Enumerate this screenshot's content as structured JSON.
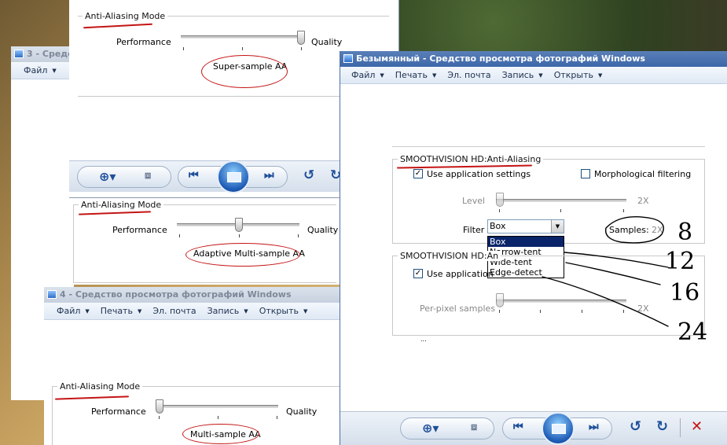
{
  "win_top": {
    "group_label": "Anti-Aliasing Mode",
    "left_label": "Performance",
    "right_label": "Quality",
    "mode": "Super-sample AA",
    "slider_level": 1.0
  },
  "win3": {
    "title": "3 - Средс",
    "menu": [
      "Файл"
    ]
  },
  "mid": {
    "group_label": "Anti-Aliasing Mode",
    "left_label": "Performance",
    "right_label": "Quality",
    "mode": "Adaptive Multi-sample AA",
    "slider_level": 0.5
  },
  "win4": {
    "title": "4 - Средство просмотра фотографий Windows",
    "menu": [
      "Файл",
      "Печать",
      "Эл. почта",
      "Запись",
      "Открыть"
    ],
    "group_label": "Anti-Aliasing Mode",
    "left_label": "Performance",
    "right_label": "Quality",
    "mode": "Multi-sample AA",
    "slider_level": 0.0
  },
  "main": {
    "title": "Безымянный - Средство просмотра фотографий Windows",
    "menu": [
      "Файл",
      "Печать",
      "Эл. почта",
      "Запись",
      "Открыть"
    ],
    "g1": {
      "label": "SMOOTHVISION HD:Anti-Aliasing",
      "use_app": "Use application settings",
      "morph": "Morphological filtering",
      "level_label": "Level",
      "level_value": "2X",
      "filter_label": "Filter",
      "filter_value": "Box",
      "samples_label": "Samples:",
      "samples_value": "2X"
    },
    "dropdown": [
      "Box",
      "Narrow-tent",
      "Wide-tent",
      "Edge-detect"
    ],
    "g2": {
      "label": "SMOOTHVISION HD:An",
      "use_app": "Use application",
      "pps_label": "Per-pixel samples",
      "pps_value": "2X",
      "dots": "..."
    }
  },
  "handwritten": [
    "8",
    "12",
    "16",
    "24"
  ],
  "colors": {
    "annotation": "#c41414",
    "titlebar": "#3d67a8",
    "selection": "#0a246a"
  }
}
